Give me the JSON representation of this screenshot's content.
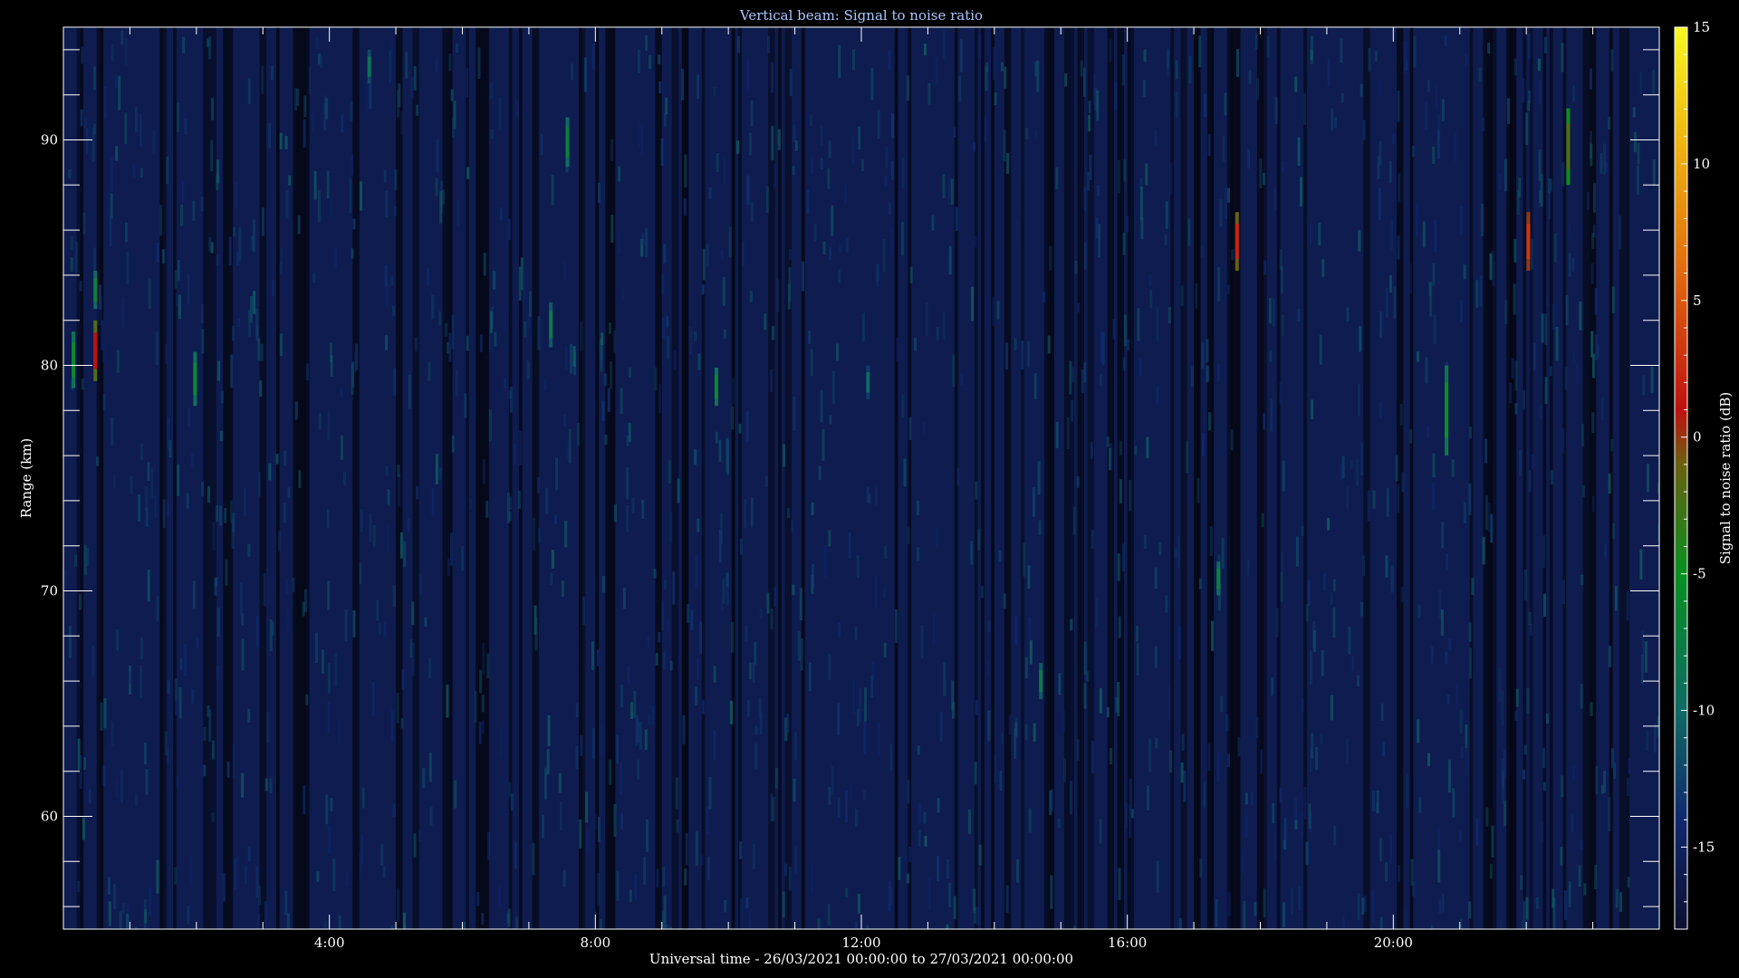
{
  "chart_data": {
    "type": "heatmap",
    "title": "Vertical beam: Signal to noise ratio",
    "xlabel": "Universal time - 26/03/2021 00:00:00 to 27/03/2021 00:00:00",
    "ylabel": "Range (km)",
    "colorbar_label": "Signal to noise ratio (dB)",
    "x_unit": "hours UT",
    "xlim": [
      0,
      24
    ],
    "ylim": [
      55,
      95
    ],
    "clim": [
      -18,
      15
    ],
    "x_ticks": [
      {
        "value": 4,
        "label": "4:00"
      },
      {
        "value": 8,
        "label": "8:00"
      },
      {
        "value": 12,
        "label": "12:00"
      },
      {
        "value": 16,
        "label": "16:00"
      },
      {
        "value": 20,
        "label": "20:00"
      }
    ],
    "y_ticks": [
      {
        "value": 60,
        "label": "60"
      },
      {
        "value": 70,
        "label": "70"
      },
      {
        "value": 80,
        "label": "80"
      },
      {
        "value": 90,
        "label": "90"
      }
    ],
    "colorbar_ticks": [
      {
        "value": 15,
        "label": "15"
      },
      {
        "value": 10,
        "label": "10"
      },
      {
        "value": 5,
        "label": "5"
      },
      {
        "value": 0,
        "label": "0"
      },
      {
        "value": -5,
        "label": "-5"
      },
      {
        "value": -10,
        "label": "-10"
      },
      {
        "value": -15,
        "label": "-15"
      }
    ],
    "background_snr_db": -16,
    "colormap": [
      {
        "value": -18,
        "color": "#0c1030"
      },
      {
        "value": -14,
        "color": "#10286e"
      },
      {
        "value": -10,
        "color": "#106a64"
      },
      {
        "value": -5,
        "color": "#089020"
      },
      {
        "value": -1,
        "color": "#6a6010"
      },
      {
        "value": 1,
        "color": "#c01010"
      },
      {
        "value": 6,
        "color": "#e06a10"
      },
      {
        "value": 11,
        "color": "#f0b810"
      },
      {
        "value": 15,
        "color": "#f8f820"
      }
    ],
    "echoes": [
      {
        "t": 0.15,
        "r0": 79.0,
        "r1": 81.5,
        "snr": -6
      },
      {
        "t": 0.48,
        "r0": 79.3,
        "r1": 82.0,
        "snr": 1
      },
      {
        "t": 0.48,
        "r0": 82.5,
        "r1": 84.2,
        "snr": -7
      },
      {
        "t": 1.98,
        "r0": 78.2,
        "r1": 80.6,
        "snr": -6
      },
      {
        "t": 4.6,
        "r0": 92.5,
        "r1": 94.0,
        "snr": -9
      },
      {
        "t": 7.33,
        "r0": 80.8,
        "r1": 82.8,
        "snr": -8
      },
      {
        "t": 7.58,
        "r0": 88.8,
        "r1": 91.0,
        "snr": -7
      },
      {
        "t": 9.82,
        "r0": 78.2,
        "r1": 79.9,
        "snr": -6
      },
      {
        "t": 12.1,
        "r0": 78.5,
        "r1": 80.0,
        "snr": -10
      },
      {
        "t": 14.7,
        "r0": 65.2,
        "r1": 66.8,
        "snr": -8
      },
      {
        "t": 17.37,
        "r0": 69.8,
        "r1": 71.3,
        "snr": -7
      },
      {
        "t": 17.65,
        "r0": 84.2,
        "r1": 86.8,
        "snr": 2
      },
      {
        "t": 20.8,
        "r0": 76.0,
        "r1": 80.0,
        "snr": -5
      },
      {
        "t": 22.03,
        "r0": 84.2,
        "r1": 86.8,
        "snr": 3
      },
      {
        "t": 22.63,
        "r0": 88.0,
        "r1": 91.4,
        "snr": -2
      }
    ]
  }
}
